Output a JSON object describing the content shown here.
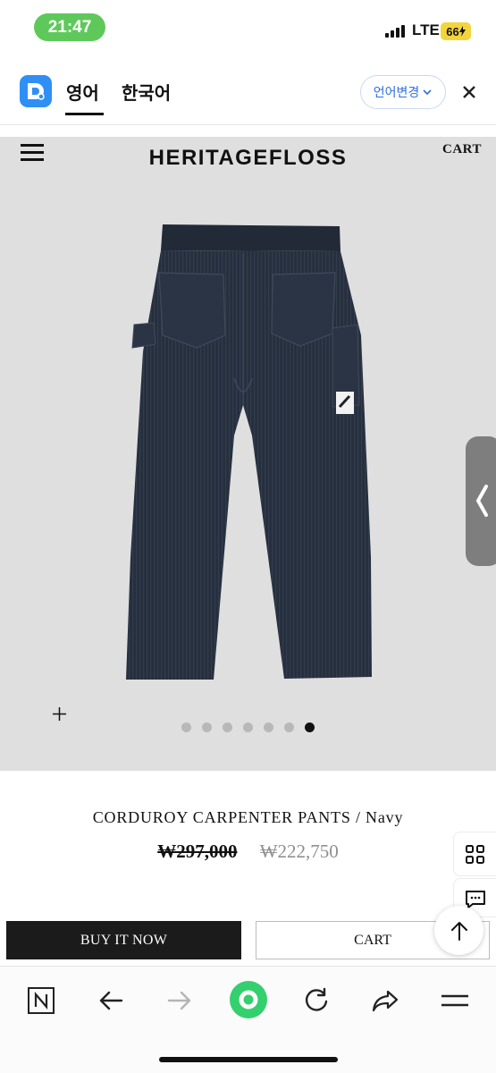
{
  "status_bar": {
    "time": "21:47",
    "network": "LTE",
    "battery": "66"
  },
  "translate_bar": {
    "active_language": "영어",
    "other_language": "한국어",
    "change_button": "언어변경",
    "icons": [
      "translate-logo-icon",
      "chevron-down-icon",
      "close-icon"
    ]
  },
  "header": {
    "brand": "HERITAGEFLOSS",
    "cart": "CART"
  },
  "gallery": {
    "image_count": 7,
    "active_index": 6,
    "icons": [
      "menu-icon",
      "plus-icon",
      "chevron-left-icon"
    ]
  },
  "product": {
    "name": "CORDUROY CARPENTER PANTS / Navy",
    "original_price": "₩297,000",
    "sale_price": "₩222,750"
  },
  "actions": {
    "buy_now": "BUY IT NOW",
    "cart": "CART"
  },
  "floating": {
    "icons": [
      "grid-icon",
      "chat-icon",
      "arrow-up-icon"
    ]
  },
  "browser_bar": {
    "icons": [
      "naver-n-icon",
      "back-arrow-icon",
      "forward-arrow-icon",
      "green-home-icon",
      "refresh-icon",
      "share-icon",
      "menu-lines-icon"
    ]
  },
  "colors": {
    "time_pill": "#5ec95a",
    "battery": "#f2d53c",
    "translate_accent": "#2f8ff5",
    "hero_bg": "#dfdfdf",
    "pants": "#27303f",
    "buy_button": "#1b1b1b",
    "browser_green": "#33d06d"
  }
}
